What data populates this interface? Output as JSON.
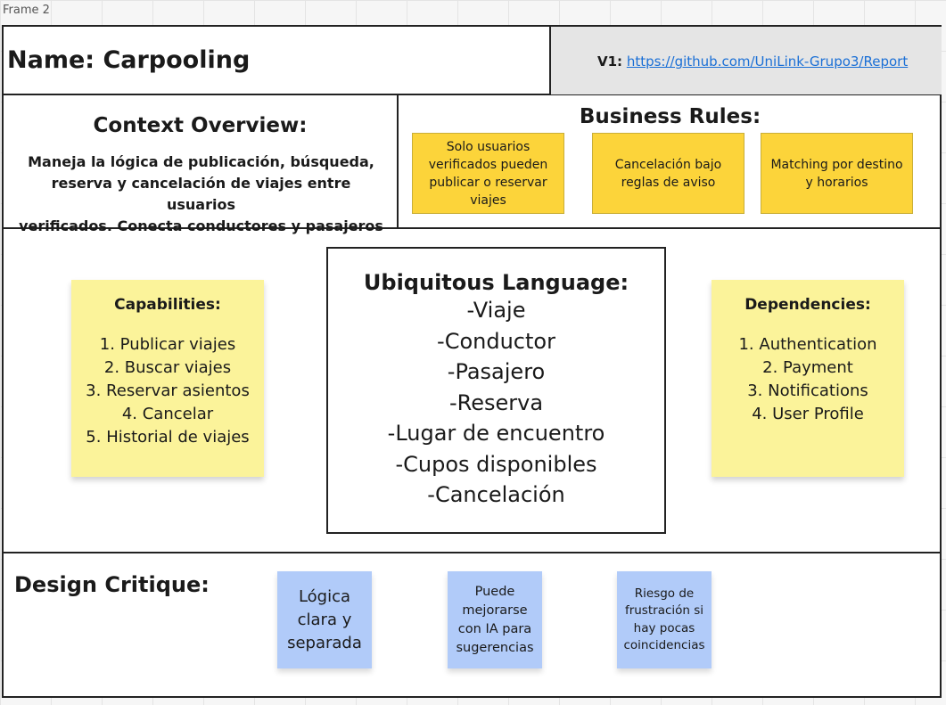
{
  "frame": {
    "label": "Frame 2"
  },
  "header": {
    "name": "Name: Carpooling",
    "version_label": "V1:",
    "repo_link": "https://github.com/UniLink-Grupo3/Report"
  },
  "context_overview": {
    "title": "Context Overview:",
    "lines": [
      "Maneja la lógica de publicación, búsqueda,",
      "reserva y cancelación de viajes entre usuarios",
      "verificados. Conecta conductores y pasajeros"
    ]
  },
  "business_rules": {
    "title": "Business Rules:",
    "notes": [
      "Solo usuarios verificados pueden publicar o reservar viajes",
      "Cancelación bajo reglas de aviso",
      "Matching por destino y horarios"
    ]
  },
  "capabilities": {
    "title": "Capabilities:",
    "items": [
      "1. Publicar viajes",
      "2. Buscar viajes",
      "3. Reservar asientos",
      "4. Cancelar",
      "5. Historial de viajes"
    ]
  },
  "ubiquitous_language": {
    "title": "Ubiquitous Language:",
    "terms": [
      "-Viaje",
      "-Conductor",
      "-Pasajero",
      "-Reserva",
      "-Lugar de encuentro",
      "-Cupos disponibles",
      "-Cancelación"
    ]
  },
  "dependencies": {
    "title": "Dependencies:",
    "items": [
      "1. Authentication",
      "2. Payment",
      "3. Notifications",
      "4. User Profile"
    ]
  },
  "design_critique": {
    "title": "Design Critique:",
    "notes": [
      "Lógica clara y separada",
      "Puede mejorarse con IA para sugerencias",
      "Riesgo de frustración si hay pocas coincidencias"
    ]
  },
  "colors": {
    "business_rule_note": "#fcd43a",
    "sticky_yellow": "#fbf39a",
    "sticky_blue": "#b1cbf9",
    "link": "#1a6fd6"
  }
}
